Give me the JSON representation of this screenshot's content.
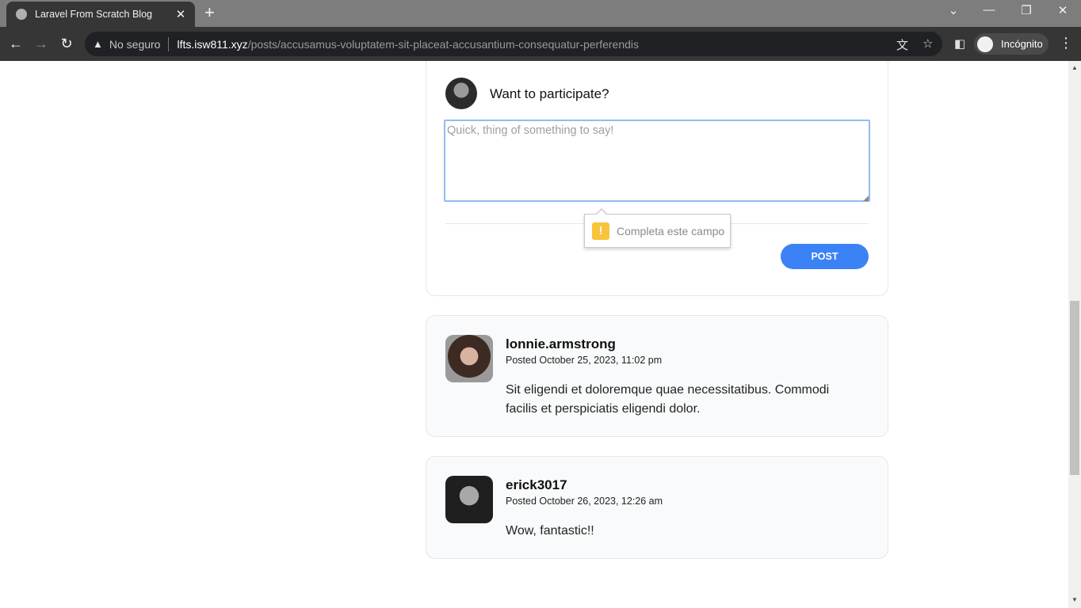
{
  "browser": {
    "tab_title": "Laravel From Scratch Blog",
    "tab_close": "✕",
    "new_tab": "+",
    "security_label": "No seguro",
    "url_host": "lfts.isw811.xyz",
    "url_path": "/posts/accusamus-voluptatem-sit-placeat-accusantium-consequatur-perferendis",
    "profile_label": "Incógnito",
    "icons": [
      "back-icon",
      "forward-icon",
      "reload-icon",
      "warning-icon",
      "translate-icon",
      "star-icon",
      "sidepanel-icon",
      "incognito-icon",
      "menu-icon"
    ]
  },
  "form": {
    "heading": "Want to participate?",
    "placeholder": "Quick, thing of something to say!",
    "post_label": "POST",
    "validation_message": "Completa este campo"
  },
  "comments": [
    {
      "username": "lonnie.armstrong",
      "posted": "Posted October 25, 2023, 11:02 pm",
      "body": "Sit eligendi et doloremque quae necessitatibus. Commodi facilis et perspiciatis eligendi dolor."
    },
    {
      "username": "erick3017",
      "posted": "Posted October 26, 2023, 12:26 am",
      "body": "Wow, fantastic!!"
    }
  ]
}
